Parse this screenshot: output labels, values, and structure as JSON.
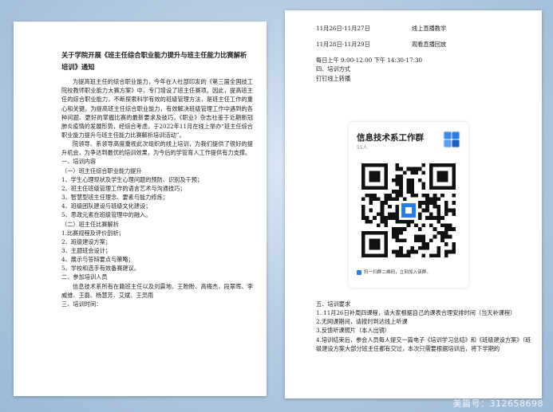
{
  "left_page": {
    "title": "关于学院开展《班主任综合职业能力提升与班主任能力比赛解析培训》通知",
    "intro_paragraphs": [
      "为提高班主任的综合职业能力，今年在人社部印发的《第三届全国技工院校教师职业能力大赛方案》中，专门增设了班主任赛项。因此，提高班主任的综合职业能力，不断探索科学有效的班级管理方法，是班主任工作的重心和关键。为提高班主任综合职业能力，有效解决班级管理工作中遇到的各种问题、更好的掌握比赛的最新要求及技巧，《职业》杂志社鉴于近期新冠肺炎疫情的发展形势，经综合考虑，于2022年11月在线上举办“班主任综合职业能力提升与班主任能力比赛解析培训活动”。",
      "院领导、系领导高度重视此次组织的线上培训，为我们提供了很好的提升机会，为争达到最优的培训效果，为今后的学管育人工作提供有力支撑。"
    ],
    "items": [
      "一、培训内容",
      "（一）班主任综合职业能力提升",
      "1、学生心理现状及学生心理问题的预防、识别及干预；",
      "2、班主任班级管理工作的语言艺术与沟通技巧；",
      "3、智慧型班主任理念、要素与能力修炼；",
      "4、班级团队建设与班级文化建设；",
      "5、思政元素在班级管理中的融入。",
      "（二）班主任比赛解析",
      "1.比赛规程及评价剖析；",
      "2、班级建设方案；",
      "3、主题班会设计；",
      "4、展示与答辩要点与策略；",
      "5、学校和选手有效备赛建议。",
      "二、参加培训人员"
    ],
    "participants_paragraph": "信息技术系所有在籍班主任以及刘震地、王盼盼、高梅杰、段翠晖、李威维、王磊、杨慧芳、艾斌、王灵雨",
    "last_item": "三、培训时间："
  },
  "right_page": {
    "schedule": [
      {
        "dates": "11月26日-11月27日",
        "mode": "线上直播教学"
      },
      {
        "dates": "11月28日-11月29日",
        "mode": "观看直播回放"
      }
    ],
    "daily_time": "每日上午 9:00-12:00 下午 14:30-17:30",
    "section4": "四、培训方式",
    "method": "钉钉线上转播",
    "qr_card": {
      "group_name": "信息技术系工作群",
      "member_count": "55人",
      "hint": "扫一扫群二维码，立刻加入该群。"
    },
    "section5": "五、培训要求",
    "requirements": [
      "1. 11月26日补周四课程，请大家根据自己的课表合理安排时间（当天补课程）",
      "2.无网课期间，请按时到达线上听课",
      "3.反馈听课照片（本人出镜）",
      "4.培训结束后，参会人员每人提交一篇电子《培训学习总结》和《班级建设方案》（班级建设方案大部分班主任都有交过，本次只需要根据培训后，将下学期的"
    ]
  },
  "watermark": "美篇号：312658698",
  "colors": {
    "background": "#b7cde3",
    "page": "#ffffff",
    "text": "#222222",
    "qr_dark": "#111111",
    "accent_blue": "#2a7de1"
  }
}
